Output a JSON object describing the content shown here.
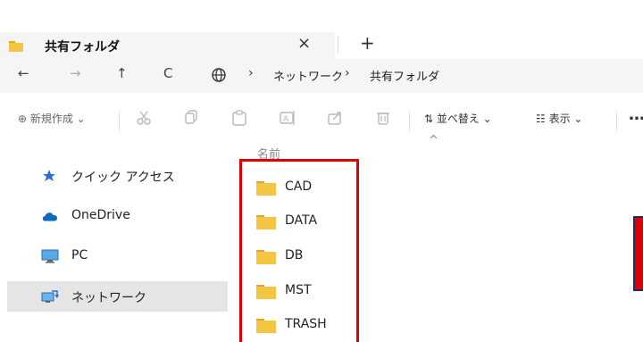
{
  "tab": {
    "title": "共有フォルダ",
    "close_glyph": "×",
    "new_glyph": "+"
  },
  "address": {
    "back_glyph": "←",
    "forward_glyph": "→",
    "up_glyph": "↑",
    "refresh_glyph": "C",
    "crumb_sep": "›",
    "crumbs": [
      "ネットワーク",
      "共有フォルダ"
    ]
  },
  "toolbar": {
    "new_label": "⊕ 新規作成 ⌄",
    "sort_label": "⇅ 並べ替え ⌄",
    "view_label": "☷ 表示 ⌄",
    "more_glyph": "…"
  },
  "sidebar": {
    "items": [
      {
        "label": "クイック アクセス",
        "icon": "star-pin-icon",
        "selected": false
      },
      {
        "label": "OneDrive",
        "icon": "cloud-icon",
        "selected": false
      },
      {
        "label": "PC",
        "icon": "monitor-icon",
        "selected": false
      },
      {
        "label": "ネットワーク",
        "icon": "network-icon",
        "selected": true
      }
    ]
  },
  "list": {
    "column_name": "名前",
    "sort_chevron": "^",
    "items": [
      "CAD",
      "DATA",
      "DB",
      "MST",
      "TRASH"
    ]
  },
  "colors": {
    "folder": "#f4c542",
    "highlight": "#e00000",
    "selected_bg": "#e5e5e5",
    "onedrive": "#0f6cbd"
  }
}
